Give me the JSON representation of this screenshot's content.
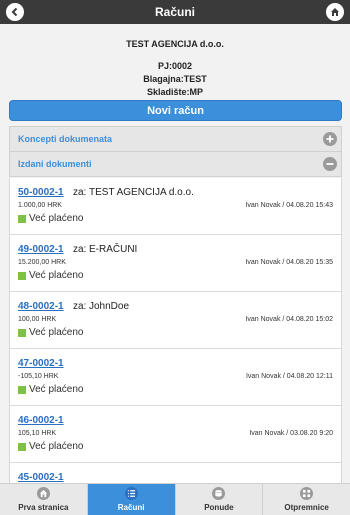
{
  "header": {
    "title": "Računi"
  },
  "info": {
    "company": "TEST AGENCIJA d.o.o.",
    "pj": "PJ:0002",
    "blagajna": "Blagajna:TEST",
    "skladiste": "Skladište:MP"
  },
  "actions": {
    "new_invoice": "Novi račun"
  },
  "sections": {
    "concepts": "Koncepti dokumenata",
    "issued": "Izdani dokumenti"
  },
  "za_label": "za:",
  "documents": [
    {
      "number": "50-0002-1",
      "customer": "TEST AGENCIJA d.o.o.",
      "amount": "1.000,00 HRK",
      "meta": "Ivan Novak / 04.08.20 15:43",
      "status": "Već plaćeno"
    },
    {
      "number": "49-0002-1",
      "customer": "E-RAČUNI",
      "amount": "15.200,00 HRK",
      "meta": "Ivan Novak / 04.08.20 15:35",
      "status": "Već plaćeno"
    },
    {
      "number": "48-0002-1",
      "customer": "JohnDoe",
      "amount": "100,00 HRK",
      "meta": "Ivan Novak / 04.08.20 15:02",
      "status": "Već plaćeno"
    },
    {
      "number": "47-0002-1",
      "customer": "",
      "amount": "-105,10 HRK",
      "meta": "Ivan Novak / 04.08.20 12:11",
      "status": "Već plaćeno"
    },
    {
      "number": "46-0002-1",
      "customer": "",
      "amount": "105,10 HRK",
      "meta": "Ivan Novak / 03.08.20 9:20",
      "status": "Već plaćeno"
    },
    {
      "number": "45-0002-1",
      "customer": "",
      "amount": "",
      "meta": "",
      "status": ""
    }
  ],
  "tabs": [
    {
      "label": "Prva stranica",
      "icon": "home-icon"
    },
    {
      "label": "Računi",
      "icon": "list-icon"
    },
    {
      "label": "Ponude",
      "icon": "database-icon"
    },
    {
      "label": "Otpremnice",
      "icon": "grid-icon"
    }
  ],
  "colors": {
    "accent": "#3c8fdb",
    "header": "#3a3a3a",
    "paid": "#7fc241"
  }
}
